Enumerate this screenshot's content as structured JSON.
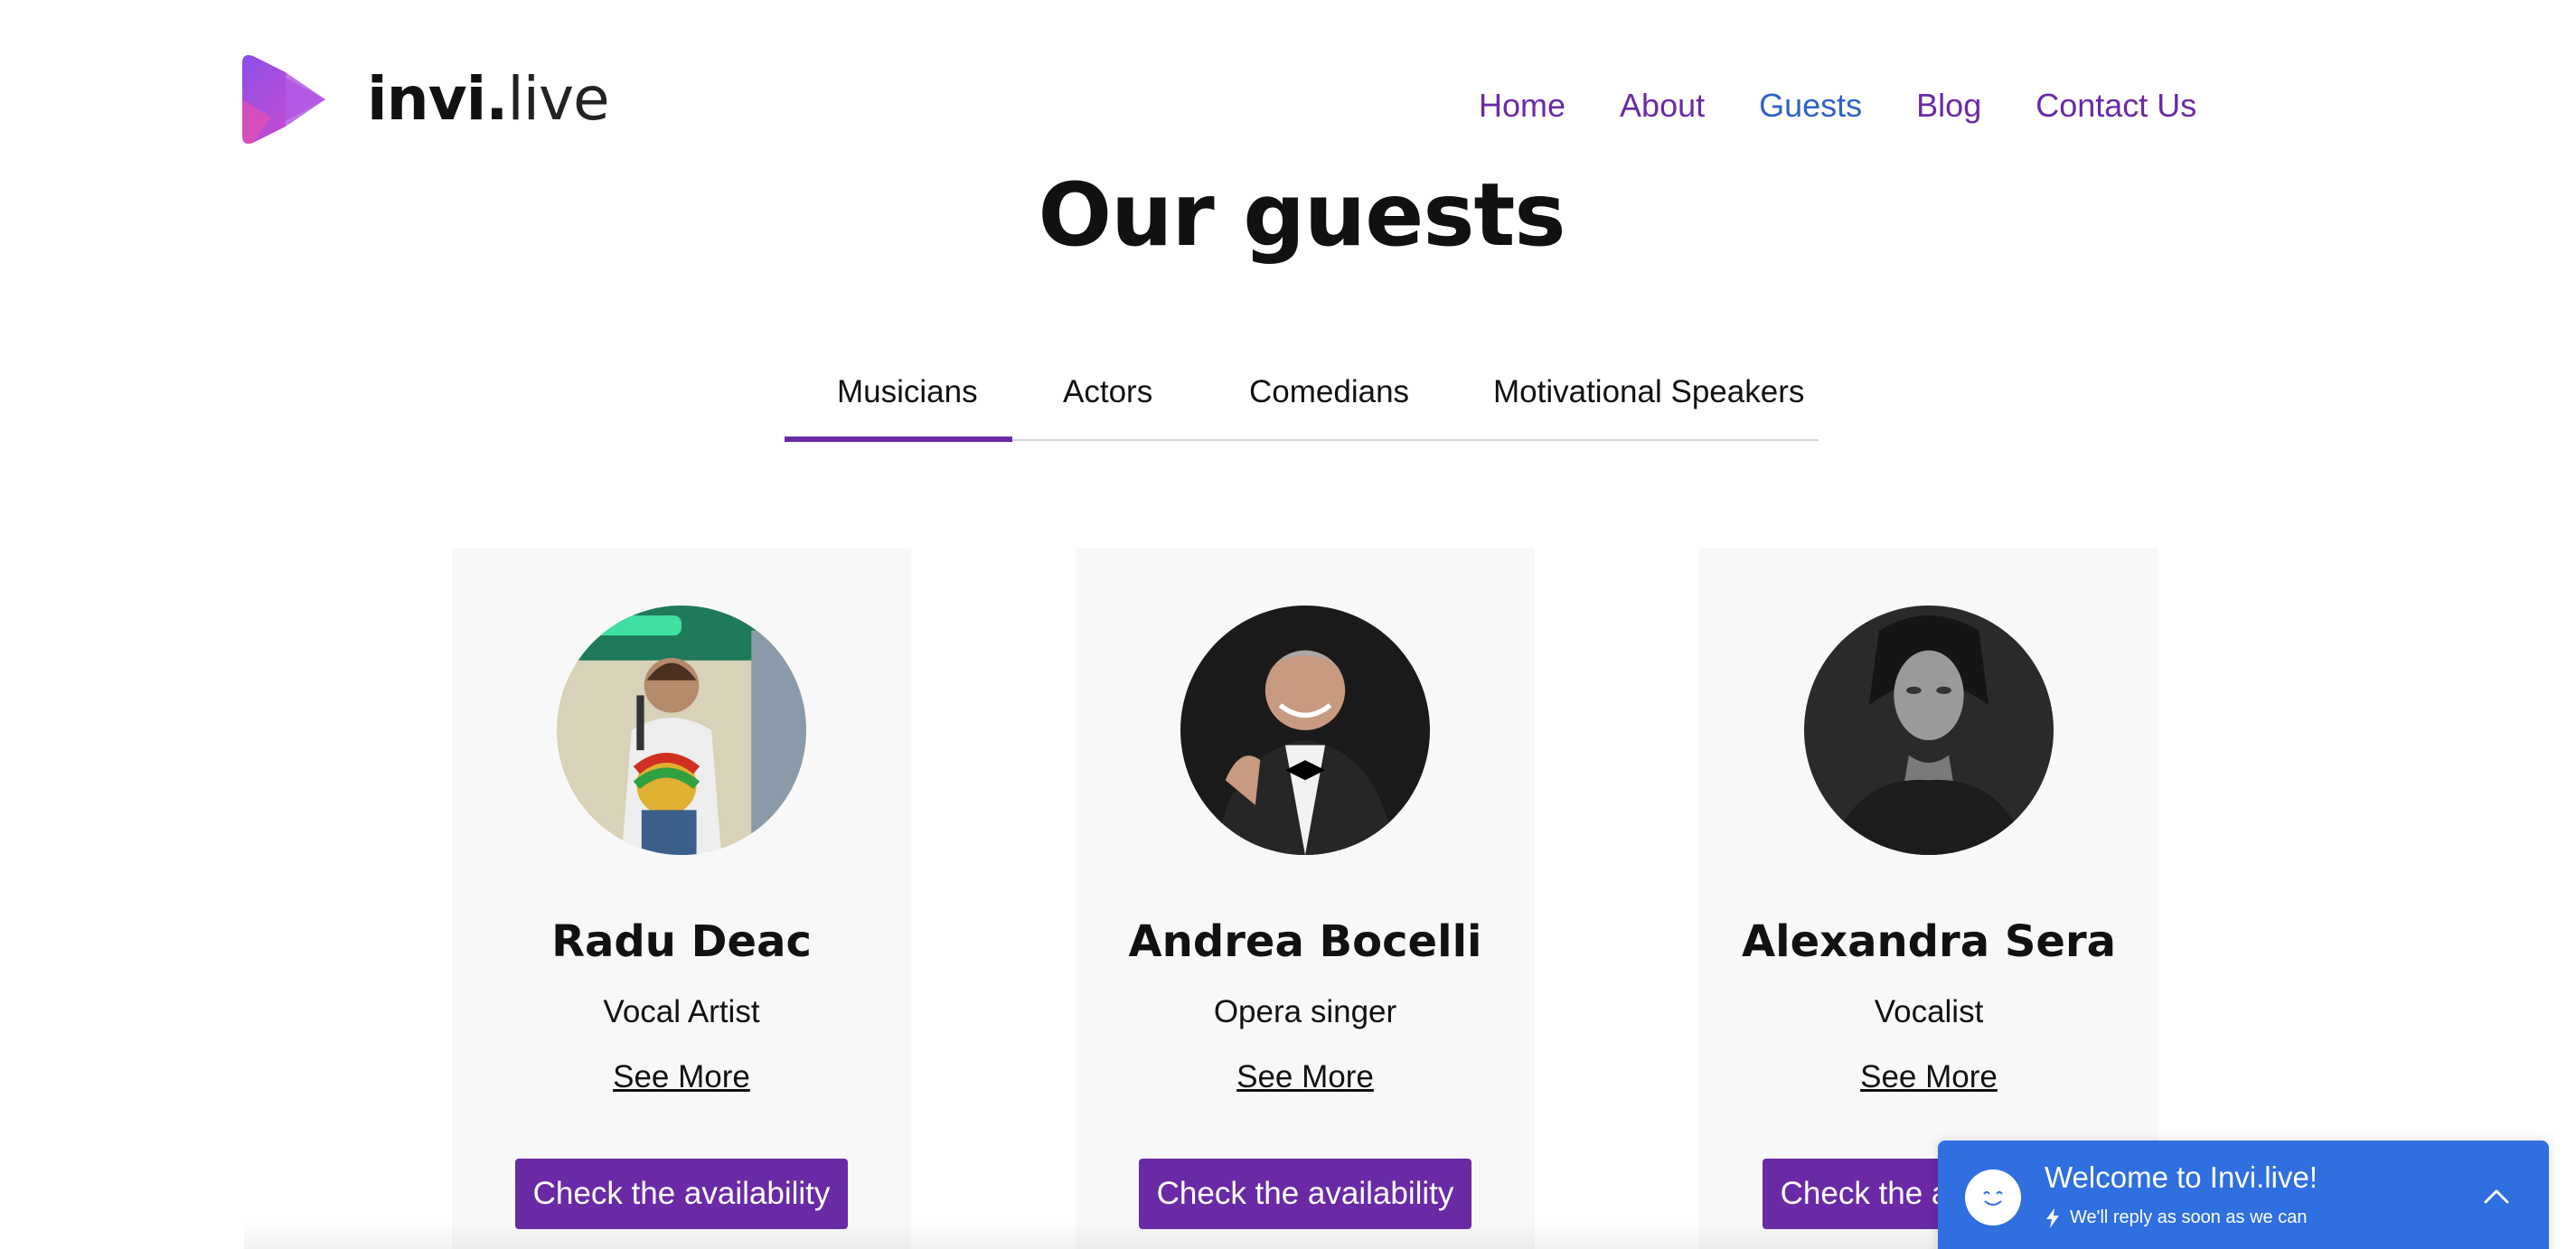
{
  "brand": {
    "name_bold": "invi.",
    "name_light": "live",
    "logo_color": "#a84ae0",
    "icon": "play-triangle-logo-icon"
  },
  "nav": {
    "items": [
      {
        "label": "Home",
        "active": false
      },
      {
        "label": "About",
        "active": false
      },
      {
        "label": "Guests",
        "active": true
      },
      {
        "label": "Blog",
        "active": false
      },
      {
        "label": "Contact Us",
        "active": false
      }
    ],
    "color": "#6a2aa6",
    "active_color": "#2f62c9"
  },
  "page": {
    "title": "Our guests"
  },
  "tabs": {
    "items": [
      {
        "label": "Musicians",
        "selected": true
      },
      {
        "label": "Actors",
        "selected": false
      },
      {
        "label": "Comedians",
        "selected": false
      },
      {
        "label": "Motivational Speakers",
        "selected": false
      }
    ],
    "accent": "#6a2aa6"
  },
  "guests": [
    {
      "name": "Radu Deac",
      "role": "Vocal Artist",
      "link": "See More",
      "cta": "Check the availability"
    },
    {
      "name": "Andrea Bocelli",
      "role": "Opera singer",
      "link": "See More",
      "cta": "Check the availability"
    },
    {
      "name": "Alexandra Sera",
      "role": "Vocalist",
      "link": "See More",
      "cta": "Check the availability"
    }
  ],
  "chat": {
    "title": "Welcome to Invi.live!",
    "subtitle": "We'll reply as soon as we can",
    "background": "#2f6fe0"
  }
}
